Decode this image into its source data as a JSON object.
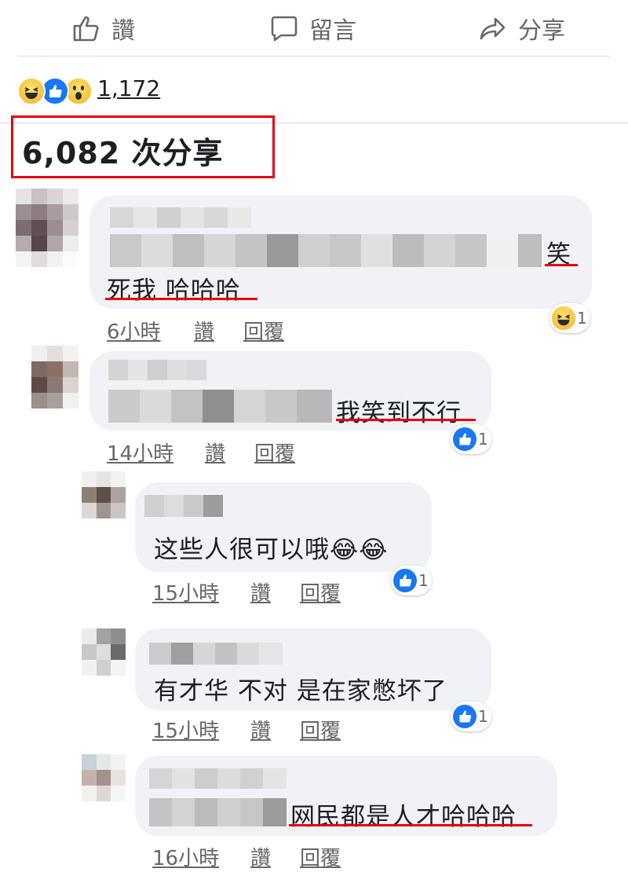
{
  "actions": {
    "like": "讚",
    "comment": "留言",
    "share": "分享"
  },
  "reactions": {
    "types": [
      "haha-icon",
      "like-icon",
      "wow-icon"
    ],
    "count": "1,172"
  },
  "shares": "6,082 次分享",
  "comments": [
    {
      "visible_text_1": "笑",
      "visible_text_2": "死我 哈哈哈",
      "time": "6小時",
      "like": "讚",
      "reply": "回覆",
      "reaction_count": "1",
      "reaction_type": "haha-icon"
    },
    {
      "visible_text": "我笑到不行",
      "time": "14小時",
      "like": "讚",
      "reply": "回覆",
      "reaction_count": "1",
      "reaction_type": "like-icon"
    },
    {
      "visible_text": "这些人很可以哦😂😂",
      "time": "15小時",
      "like": "讚",
      "reply": "回覆",
      "reaction_count": "1",
      "reaction_type": "like-icon"
    },
    {
      "visible_text": "有才华 不对 是在家憋坏了",
      "time": "15小時",
      "like": "讚",
      "reply": "回覆",
      "reaction_count": "1",
      "reaction_type": "like-icon"
    },
    {
      "visible_text": "网民都是人才哈哈哈",
      "time": "16小時",
      "like": "讚",
      "reply": "回覆"
    }
  ],
  "colors": {
    "highlight": "#e60012",
    "bubble": "#f0f2f5",
    "like_blue": "#1877f2",
    "meta": "#65676b"
  }
}
